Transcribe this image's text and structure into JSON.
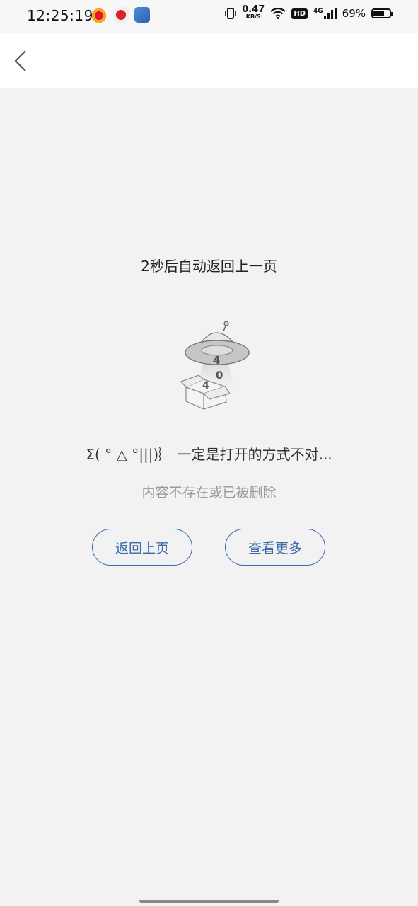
{
  "status_bar": {
    "time": "12:25:19",
    "net_speed_value": "0.47",
    "net_speed_unit": "KB/S",
    "hd_label": "HD",
    "network_label": "4G",
    "battery_text": "69%",
    "battery_level": 0.69,
    "notification_icons": [
      "weibo-icon",
      "news-app-icon",
      "stock-app-icon"
    ]
  },
  "nav": {
    "back_icon": "chevron-left-icon"
  },
  "page": {
    "countdown_text": "2秒后自动返回上一页",
    "illustration_digits": [
      "4",
      "0",
      "4"
    ],
    "headline": "Σ( ° △ °|||)︴ 一定是打开的方式不对...",
    "subtext": "内容不存在或已被删除"
  },
  "buttons": {
    "back_label": "返回上页",
    "more_label": "查看更多"
  },
  "colors": {
    "accent": "#3d6aa8",
    "background": "#f2f2f2",
    "subtext": "#9a9a9a"
  }
}
